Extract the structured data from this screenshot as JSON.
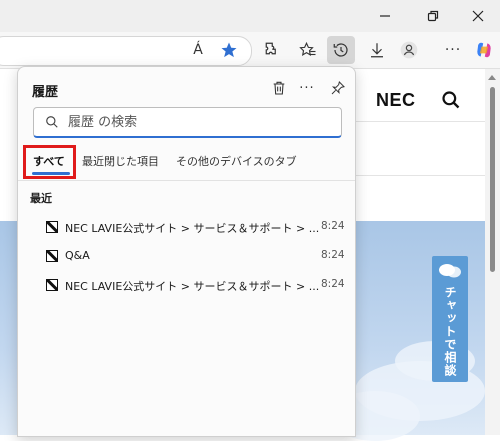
{
  "window": {
    "icons": [
      "minimize-icon",
      "restore-icon",
      "close-icon"
    ]
  },
  "toolbar": {
    "icons": [
      "read-aloud-icon",
      "favorite-star-icon",
      "extensions-icon",
      "favorites-icon",
      "history-icon",
      "downloads-icon",
      "profile-icon",
      "copilot-icon"
    ],
    "read_aloud": "Á",
    "accent": "#2f6fd1"
  },
  "page": {
    "logo": "NEC",
    "chat_tab": "チャットで相談"
  },
  "history": {
    "title": "履歴",
    "search": {
      "value": "",
      "placeholder": "履歴 の検索"
    },
    "tabs": [
      {
        "label": "すべて"
      },
      {
        "label": "最近閉じた項目"
      },
      {
        "label": "その他のデバイスのタブ"
      }
    ],
    "section": "最近",
    "items": [
      {
        "title": "NEC LAVIE公式サイト > サービス＆サポート > ...",
        "time": "8:24"
      },
      {
        "title": "Q&A",
        "time": "8:24"
      },
      {
        "title": "NEC LAVIE公式サイト > サービス＆サポート > ...",
        "time": "8:24"
      }
    ],
    "highlight_color": "#e01b1b"
  }
}
